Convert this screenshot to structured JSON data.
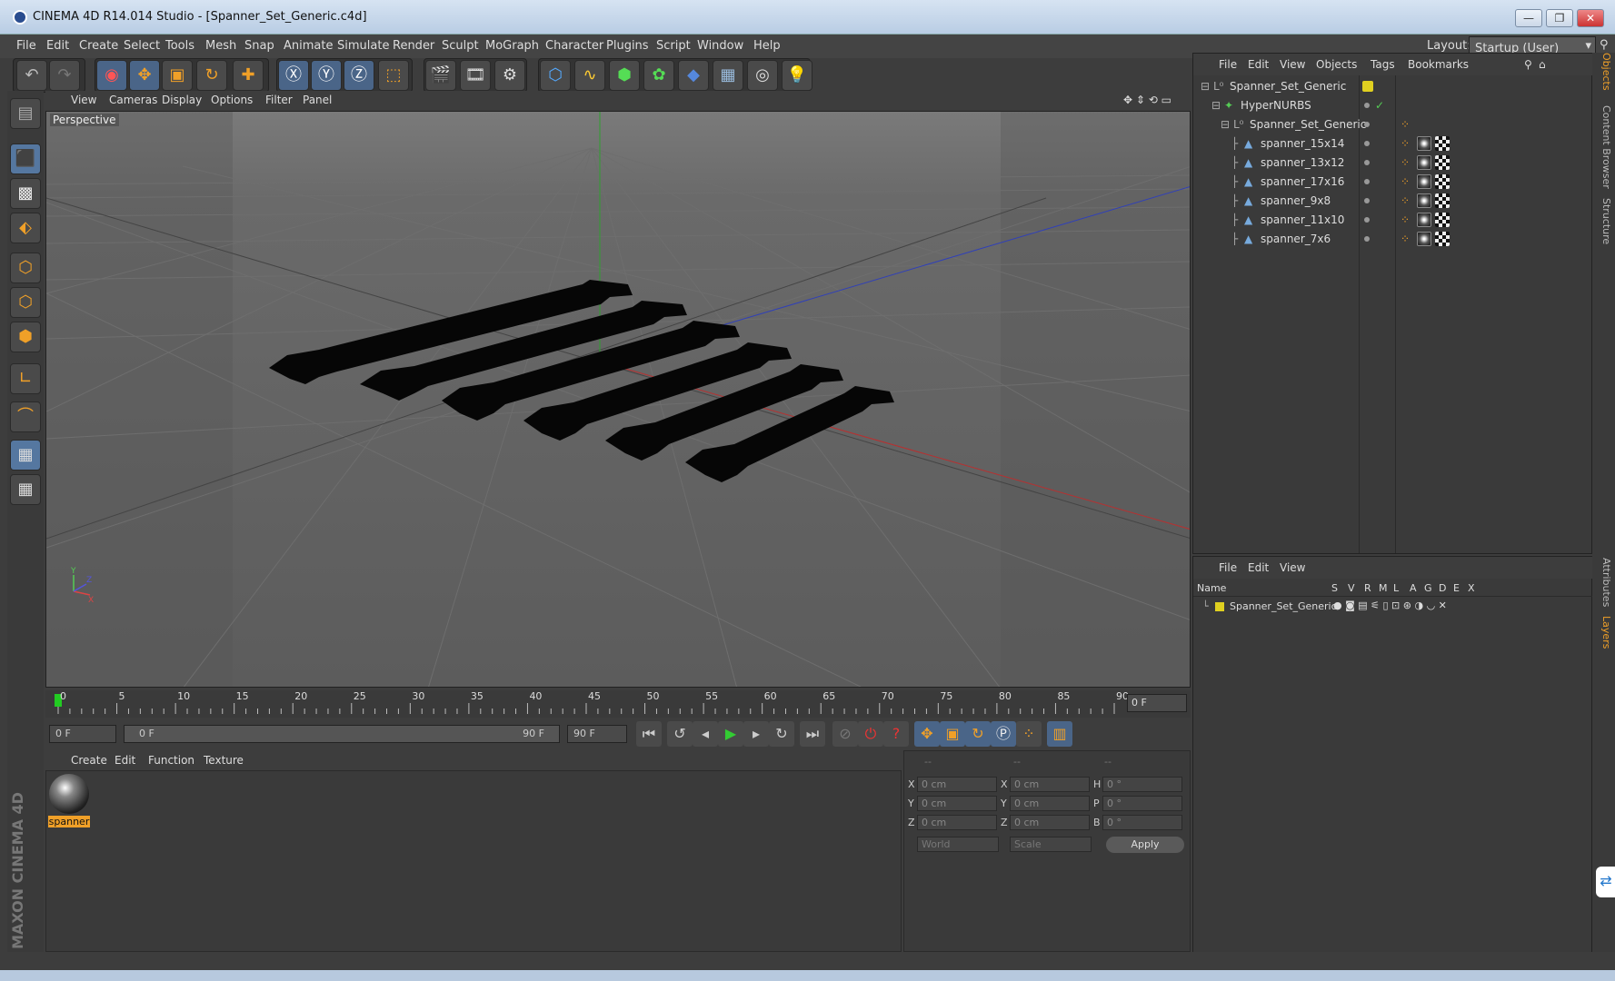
{
  "window": {
    "title": "CINEMA 4D R14.014 Studio - [Spanner_Set_Generic.c4d]"
  },
  "menubar": {
    "items": [
      "File",
      "Edit",
      "Create",
      "Select",
      "Tools",
      "Mesh",
      "Snap",
      "Animate",
      "Simulate",
      "Render",
      "Sculpt",
      "MoGraph",
      "Character",
      "Plugins",
      "Script",
      "Window",
      "Help"
    ],
    "layout_label": "Layout:",
    "layout_value": "Startup (User)"
  },
  "viewport": {
    "menu": [
      "View",
      "Cameras",
      "Display",
      "Options",
      "Filter",
      "Panel"
    ],
    "label": "Perspective"
  },
  "timeline": {
    "ticks": [
      "0",
      "5",
      "10",
      "15",
      "20",
      "25",
      "30",
      "35",
      "40",
      "45",
      "50",
      "55",
      "60",
      "65",
      "70",
      "75",
      "80",
      "85",
      "90"
    ],
    "current_frame": "0 F"
  },
  "playback": {
    "start": "0 F",
    "range_start": "0 F",
    "range_end": "90 F",
    "end": "90 F"
  },
  "materials": {
    "menu": [
      "Create",
      "Edit",
      "Function",
      "Texture"
    ],
    "items": [
      {
        "name": "spanner"
      }
    ]
  },
  "coordinates": {
    "headers": [
      "--",
      "--",
      "--"
    ],
    "rows": [
      {
        "l1": "X",
        "v1": "0 cm",
        "l2": "X",
        "v2": "0 cm",
        "l3": "H",
        "v3": "0 °"
      },
      {
        "l1": "Y",
        "v1": "0 cm",
        "l2": "Y",
        "v2": "0 cm",
        "l3": "P",
        "v3": "0 °"
      },
      {
        "l1": "Z",
        "v1": "0 cm",
        "l2": "Z",
        "v2": "0 cm",
        "l3": "B",
        "v3": "0 °"
      }
    ],
    "mode": "World",
    "transform": "Scale",
    "apply": "Apply"
  },
  "objects": {
    "menu": [
      "File",
      "Edit",
      "View",
      "Objects",
      "Tags",
      "Bookmarks"
    ],
    "tree": [
      {
        "name": "Spanner_Set_Generic",
        "indent": 0,
        "icon": "null-icon"
      },
      {
        "name": "HyperNURBS",
        "indent": 1,
        "icon": "hypernurbs-icon"
      },
      {
        "name": "Spanner_Set_Generic",
        "indent": 2,
        "icon": "null-icon"
      },
      {
        "name": "spanner_15x14",
        "indent": 3,
        "icon": "polygon-icon"
      },
      {
        "name": "spanner_13x12",
        "indent": 3,
        "icon": "polygon-icon"
      },
      {
        "name": "spanner_17x16",
        "indent": 3,
        "icon": "polygon-icon"
      },
      {
        "name": "spanner_9x8",
        "indent": 3,
        "icon": "polygon-icon"
      },
      {
        "name": "spanner_11x10",
        "indent": 3,
        "icon": "polygon-icon"
      },
      {
        "name": "spanner_7x6",
        "indent": 3,
        "icon": "polygon-icon"
      }
    ]
  },
  "layers": {
    "menu": [
      "File",
      "Edit",
      "View"
    ],
    "columns": [
      "Name",
      "S",
      "V",
      "R",
      "M",
      "L",
      "A",
      "G",
      "D",
      "E",
      "X"
    ],
    "rows": [
      {
        "name": "Spanner_Set_Generic",
        "color": "#e0d020"
      }
    ]
  },
  "right_tabs": [
    "Objects",
    "Content Browser",
    "Structure",
    "Attributes",
    "Layers"
  ],
  "brand": {
    "text": "MAXON CINEMA 4D"
  },
  "colors": {
    "accent": "#f0a028",
    "selected_blue": "#5577a0",
    "axis_x": "#c03030",
    "axis_y": "#30b030",
    "axis_z": "#3040c0"
  }
}
